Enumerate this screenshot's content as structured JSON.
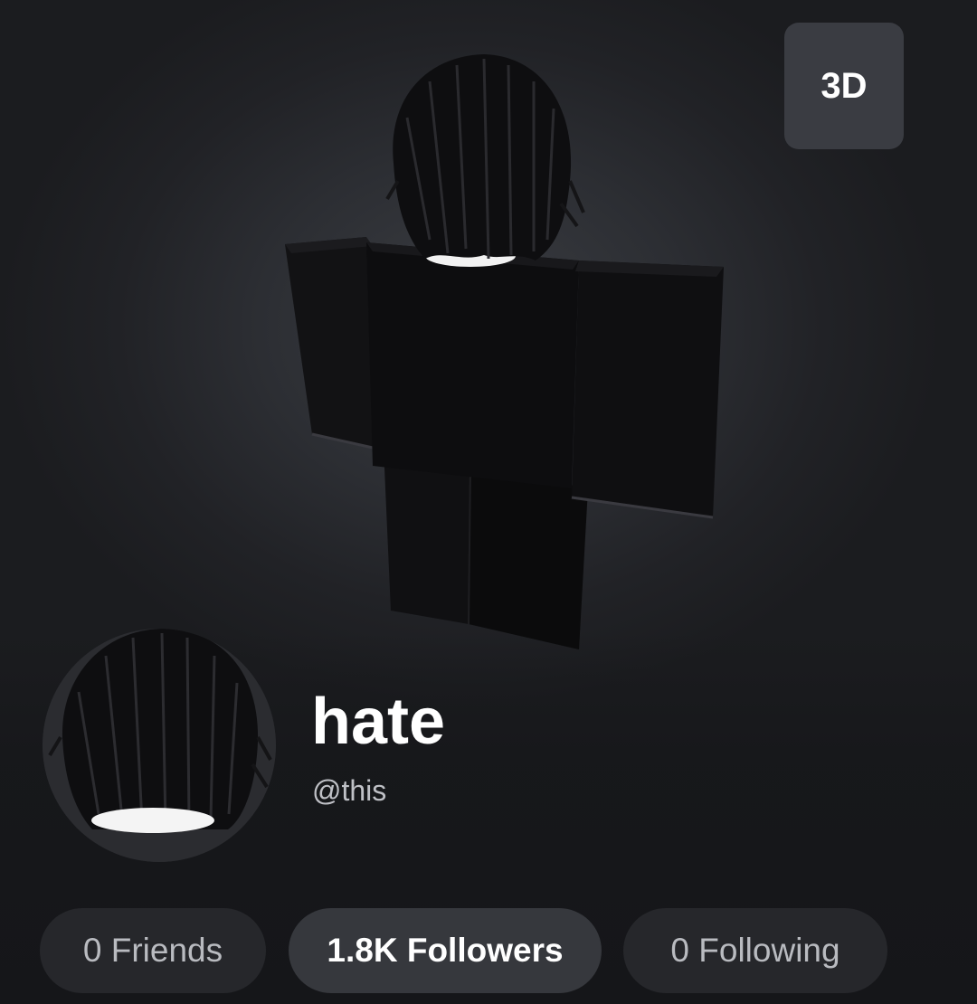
{
  "viewer": {
    "toggle_label": "3D"
  },
  "profile": {
    "display_name": "hate",
    "username": "@this"
  },
  "stats": {
    "friends": "0 Friends",
    "followers": "1.8K Followers",
    "following": "0 Following"
  },
  "colors": {
    "background": "#1b1c1f",
    "pill": "#26272b",
    "pill_active": "#36383d",
    "text_primary": "#ffffff",
    "text_secondary": "#bfc1c6"
  }
}
